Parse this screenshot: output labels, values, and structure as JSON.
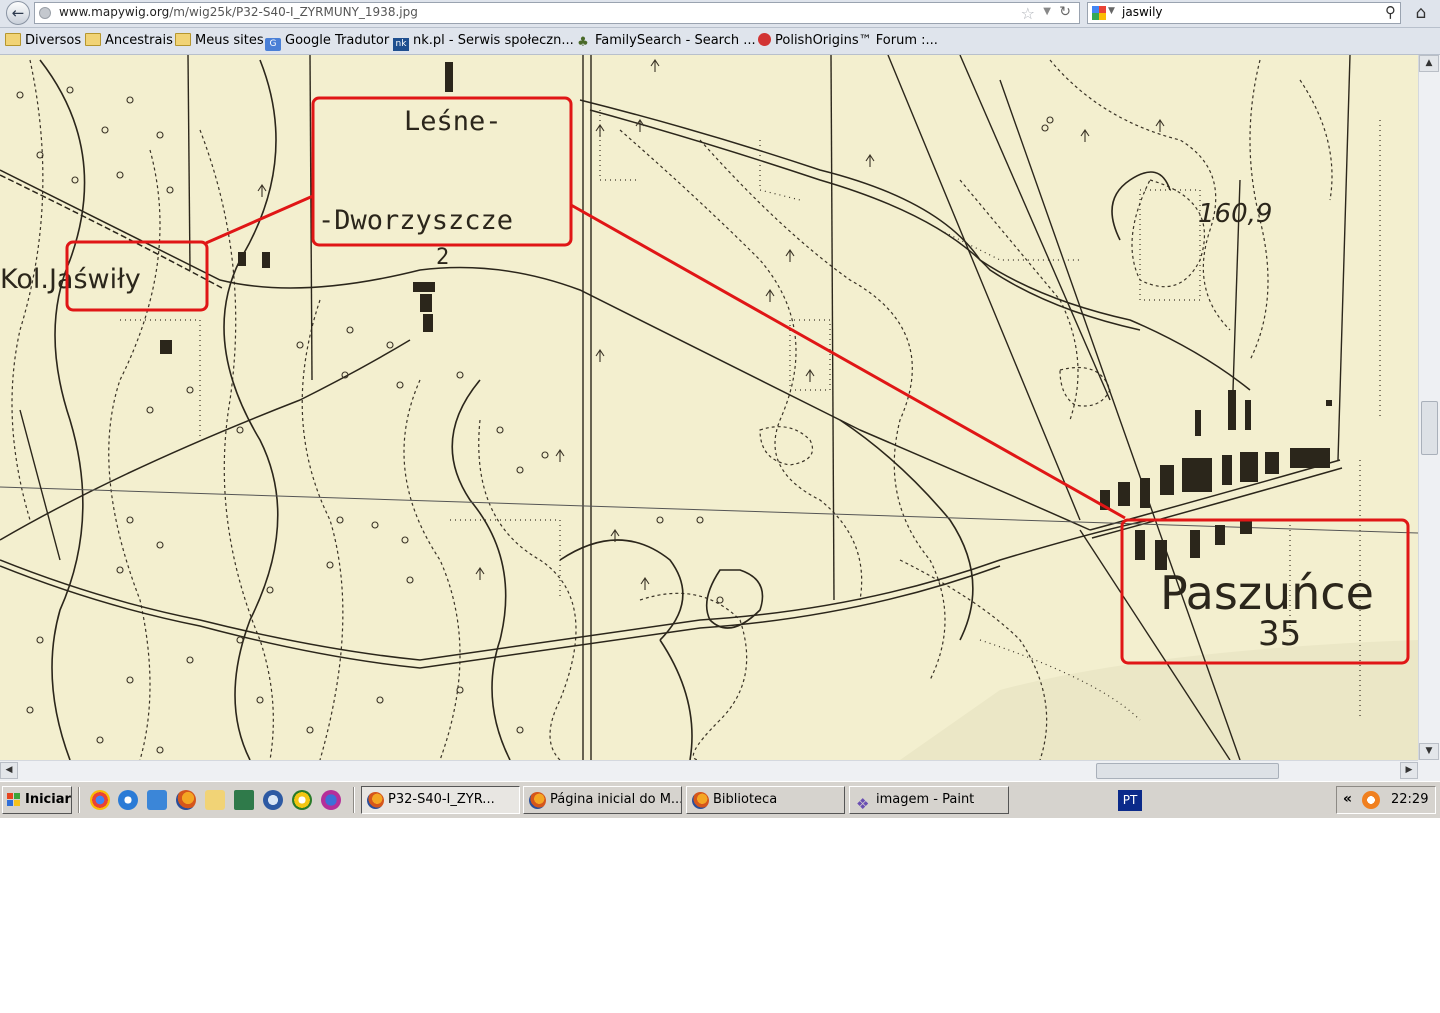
{
  "browser": {
    "url_host": "www.mapywig.org",
    "url_path": "/m/wig25k/P32-S40-I_ZYRMUNY_1938.jpg",
    "search_value": "jaswily",
    "icons": {
      "back": "back-arrow-icon",
      "bookmark": "star-icon",
      "reload": "reload-icon",
      "search": "magnifier-icon",
      "home": "home-icon"
    }
  },
  "bookmarks": [
    {
      "label": "Diversos",
      "icon": "folder-icon"
    },
    {
      "label": "Ancestrais",
      "icon": "folder-icon"
    },
    {
      "label": "Meus sites",
      "icon": "folder-icon"
    },
    {
      "label": "Google Tradutor",
      "icon": "google-translate-icon"
    },
    {
      "label": "nk.pl - Serwis społeczn...",
      "icon": "nk-icon"
    },
    {
      "label": "FamilySearch - Search ...",
      "icon": "tree-icon"
    },
    {
      "label": "PolishOrigins™ Forum :...",
      "icon": "polishorigins-icon"
    }
  ],
  "map": {
    "labels": {
      "kol_jaswily": "Kol.Jaświły",
      "lesne": "Leśne-",
      "dworzyszcze": "-Dworzyszcze",
      "lesne_count": "2",
      "paszunce": "Paszuńce",
      "paszunce_count": "35",
      "elevation": "160,9"
    },
    "colors": {
      "paper": "#f3efcf",
      "ink": "#2b261b",
      "highlight": "#e01616"
    }
  },
  "taskbar": {
    "start_label": "Iniciar",
    "quick_launch": [
      "chrome-icon",
      "internet-explorer-icon",
      "ie-alt-icon",
      "firefox-icon",
      "search-folder-icon",
      "desktop-icon",
      "thunderbird-icon",
      "media-player-icon",
      "network-icon"
    ],
    "tasks": [
      {
        "label": "P32-S40-I_ZYR...",
        "active": true
      },
      {
        "label": "Página inicial do M...",
        "active": false
      },
      {
        "label": "Biblioteca",
        "active": false
      },
      {
        "label": "imagem - Paint",
        "active": false
      }
    ],
    "language": "PT",
    "clock": "22:29"
  }
}
